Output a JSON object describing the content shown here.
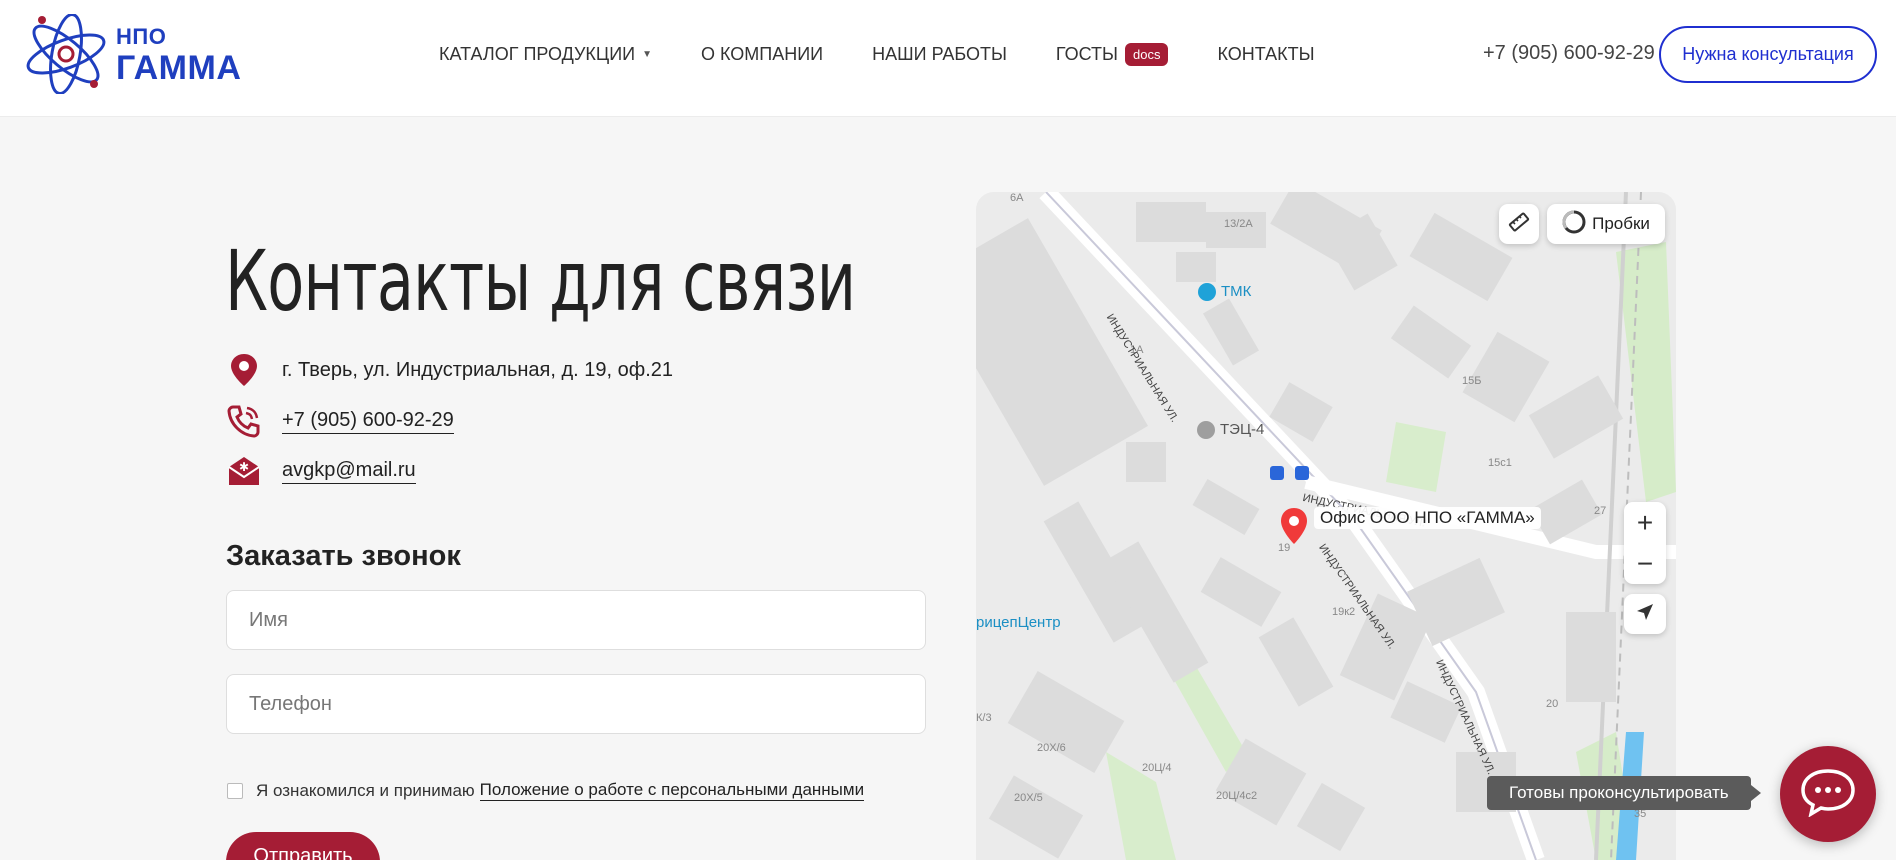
{
  "header": {
    "logo_top": "НПО",
    "logo_main": "ГАММА",
    "nav": [
      {
        "label": "КАТАЛОГ ПРОДУКЦИИ"
      },
      {
        "label": "О КОМПАНИИ"
      },
      {
        "label": "НАШИ РАБОТЫ"
      },
      {
        "label": "ГОСТЫ",
        "badge": "docs"
      },
      {
        "label": "КОНТАКТЫ"
      }
    ],
    "phone": "+7 (905) 600-92-29",
    "consult_label": "Нужна консультация"
  },
  "contacts": {
    "title": "Контакты для связи",
    "address": "г. Тверь, ул. Индустриальная, д. 19, оф.21",
    "phone": "+7 (905) 600-92-29",
    "email": "avgkp@mail.ru"
  },
  "form": {
    "title": "Заказать звонок",
    "name_placeholder": "Имя",
    "phone_placeholder": "Телефон",
    "agree_text": "Я ознакомился и принимаю",
    "agree_link": "Положение о работе с персональными данными",
    "submit_label": "Отправить"
  },
  "map": {
    "traffic_label": "Пробки",
    "office_label": "Офис ООО НПО «ГАММА»",
    "labels": {
      "street_1": "ИНДУСТРИАЛЬНАЯ УЛ.",
      "street_2": "ИНДУСТРИАЛЬНАЯ УЛ.",
      "street_3": "ИНДУСТРИАЛЬНАЯ УЛ.",
      "street_4": "ИНДУСТРИАЛЬНАЯ УЛ.",
      "poi_tmk": "ТМК",
      "poi_tec": "ТЭЦ-4",
      "poi_pricep": "рицепЦентр",
      "b_6a": "6А",
      "b_13_2a": "13/2А",
      "b_1a": "1А",
      "b_15b": "15Б",
      "b_15c1": "15с1",
      "b_27": "27",
      "b_19": "19",
      "b_19k2": "19к2",
      "b_20": "20",
      "b_k3": "К/3",
      "b_20kh6": "20Х/6",
      "b_20ts4": "20Ц/4",
      "b_20kh5": "20Х/5",
      "b_20ts4c2": "20Ц/4с2",
      "b_35": "35"
    }
  },
  "chat": {
    "tooltip": "Готовы проконсультировать"
  },
  "colors": {
    "brand_blue": "#1f3fbf",
    "brand_red": "#a51d35"
  }
}
